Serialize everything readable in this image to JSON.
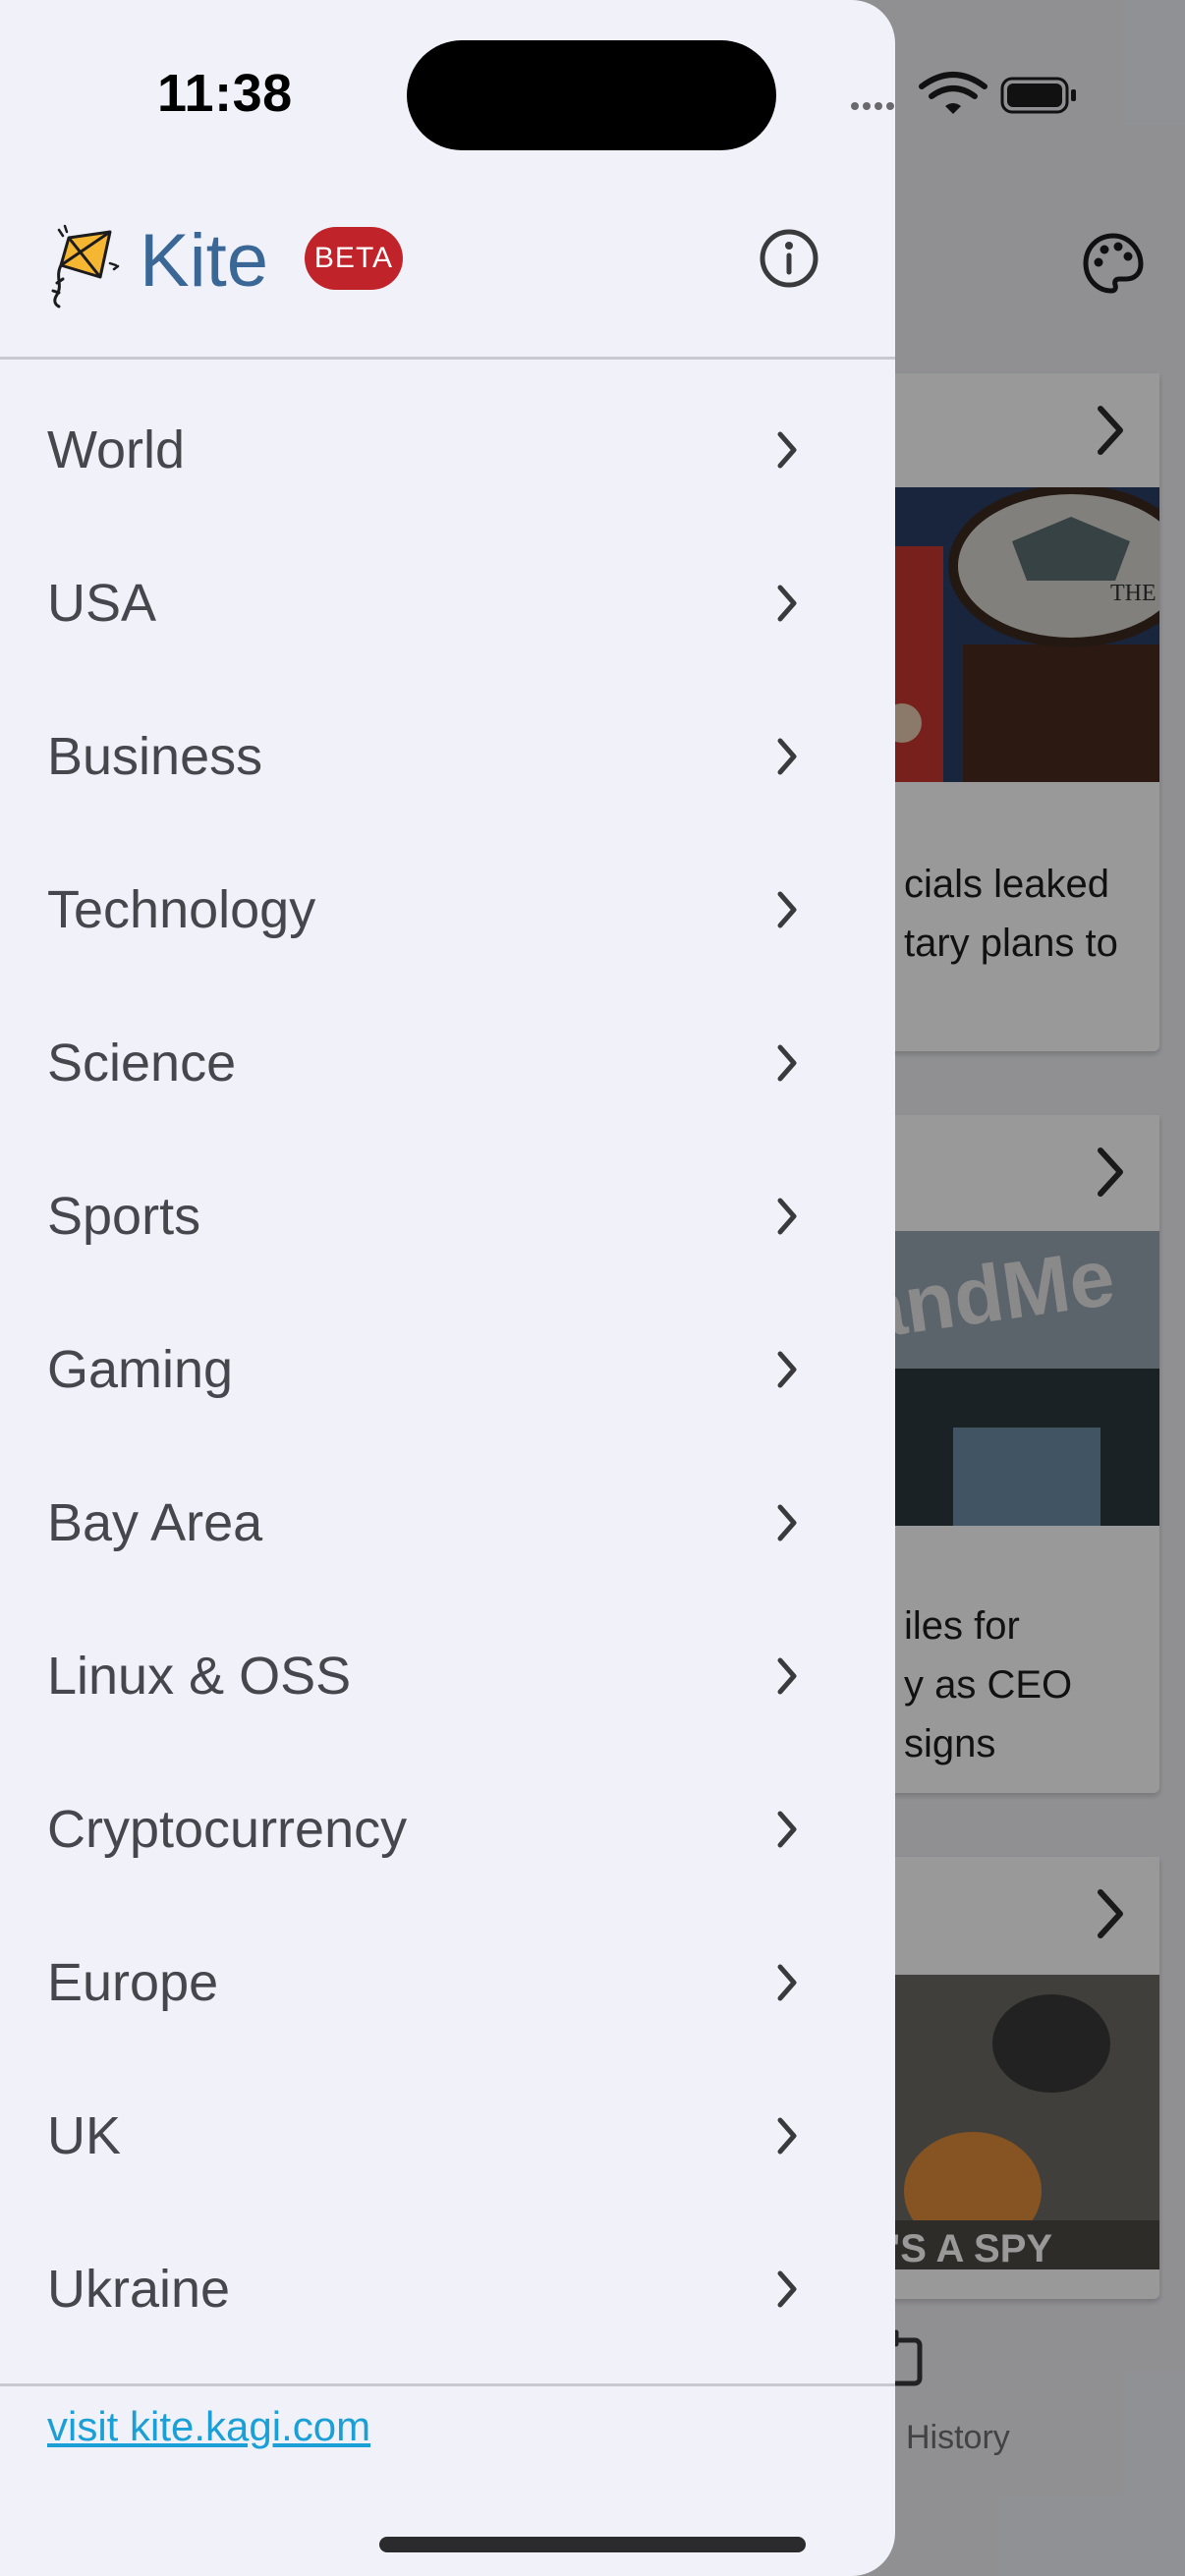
{
  "status_bar": {
    "time": "11:38"
  },
  "drawer": {
    "brand": "Kite",
    "badge": "BETA",
    "menu": [
      {
        "label": "World"
      },
      {
        "label": "USA"
      },
      {
        "label": "Business"
      },
      {
        "label": "Technology"
      },
      {
        "label": "Science"
      },
      {
        "label": "Sports"
      },
      {
        "label": "Gaming"
      },
      {
        "label": "Bay Area"
      },
      {
        "label": "Linux & OSS"
      },
      {
        "label": "Cryptocurrency"
      },
      {
        "label": "Europe"
      },
      {
        "label": "UK"
      },
      {
        "label": "Ukraine"
      }
    ],
    "footer_link": "visit kite.kagi.com"
  },
  "background": {
    "cards": [
      {
        "title_fragment": "cials leaked\ntary plans to",
        "image_text": "THE PENTAG"
      },
      {
        "title_fragment": "iles for\ny as CEO\nsigns",
        "image_text": "andMe"
      },
      {
        "title_fragment": "",
        "image_text": "E'S A SPY"
      }
    ],
    "tab_label": "History"
  },
  "colors": {
    "accent": "#3a6796",
    "badge": "#c1232a",
    "link": "#1a9fd6",
    "drawer_bg": "#f1f2f9"
  },
  "icons": {
    "logo": "kite-icon",
    "info": "info-circle-icon",
    "palette": "palette-icon",
    "chevron": "chevron-right-icon"
  }
}
